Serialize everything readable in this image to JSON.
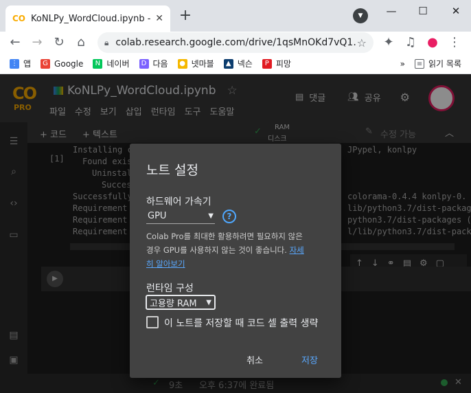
{
  "browser": {
    "tab_title": "KoNLPy_WordCloud.ipynb - Col",
    "tab_favicon": "CO",
    "url": "colab.research.google.com/drive/1qsMnOKd7vQ1...",
    "bookmarks": [
      {
        "label": "앱",
        "color": "#4285f4"
      },
      {
        "label": "Google",
        "color": "#ea4335"
      },
      {
        "label": "네이버",
        "color": "#03c75a"
      },
      {
        "label": "다음",
        "color": "#7b61ff"
      },
      {
        "label": "넷마블",
        "color": "#f5b800"
      },
      {
        "label": "넥슨",
        "color": "#0c3d6e"
      },
      {
        "label": "피망",
        "color": "#e11b22"
      }
    ],
    "reading_list": "읽기 목록",
    "more": "»"
  },
  "colab": {
    "logo": "CO",
    "pro_badge": "PRO",
    "notebook_title": "KoNLPy_WordCloud.ipynb",
    "menu": [
      "파일",
      "수정",
      "보기",
      "삽입",
      "런타임",
      "도구",
      "도움말"
    ],
    "comment_label": "댓글",
    "share_label": "공유",
    "add_code": "+ 코드",
    "add_text": "+ 텍스트",
    "ram_label": "RAM",
    "disk_label": "디스크",
    "edit_label": "수정 가능",
    "cell_exec_count": "[1]",
    "code_lines": [
      "Installing c",
      "Found exis",
      "Uninstal",
      "Succes",
      "Successfully",
      "Requirement",
      "Requirement",
      "Requirement"
    ],
    "code_right": [
      "JPypel, konlpy",
      "",
      "",
      "",
      "colorama-0.4.4 konlpy-0.",
      "lib/python3.7/dist-package",
      "python3.7/dist-packages (",
      "l/lib/python3.7/dist-pack"
    ],
    "status_time": "9초",
    "status_text": "오후 6:37에 완료됨",
    "accent": "#f9ab00"
  },
  "dialog": {
    "title": "노트 설정",
    "accelerator_label": "하드웨어 가속기",
    "accelerator_value": "GPU",
    "help_icon": "?",
    "desc_text": "Colab Pro를 최대한 활용하려면 필요하지 않은 경우 GPU를 사용하지 않는 것이 좋습니다.",
    "learn_more": "자세히 알아보기",
    "runtime_label": "런타임 구성",
    "runtime_value": "고용량 RAM",
    "checkbox_label": "이 노트를 저장할 때 코드 셀 출력 생략",
    "cancel": "취소",
    "save": "저장"
  }
}
